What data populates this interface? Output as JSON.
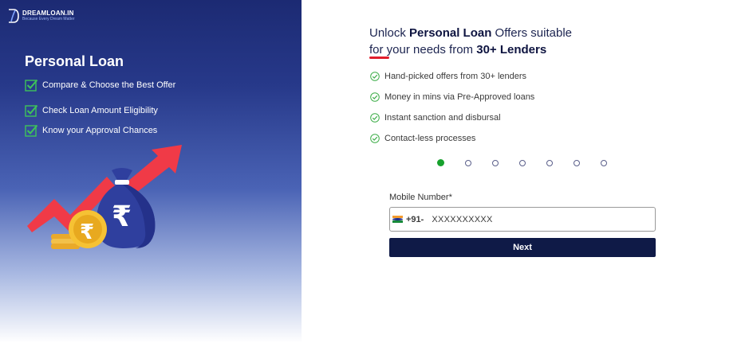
{
  "brand": {
    "name": "DREAMLOAN.IN",
    "tagline": "Because Every Dream Matter"
  },
  "left_panel": {
    "title": "Personal Loan",
    "features": [
      "Compare & Choose the Best Offer",
      "Check Loan Amount Eligibility",
      "Know your Approval Chances"
    ]
  },
  "headline": {
    "line1_prefix": "Unlock ",
    "line1_bold": "Personal Loan",
    "line1_suffix": " Offers suitable",
    "line2_prefix": "for your needs from ",
    "line2_bold": "30+ Lenders"
  },
  "benefits": [
    "Hand-picked offers from 30+ lenders",
    "Money in mins via Pre-Approved loans",
    "Instant sanction and disbursal",
    "Contact-less processes"
  ],
  "carousel": {
    "total_steps": 7,
    "active_step": 1
  },
  "form": {
    "mobile_label": "Mobile Number*",
    "country_code": "+91-",
    "mobile_placeholder": "XXXXXXXXXX",
    "mobile_value": "",
    "next_label": "Next"
  },
  "colors": {
    "accent_navy": "#0f1a47",
    "success_green": "#17a12d",
    "underline_red": "#e11d2b",
    "arrow_red": "#f03a47"
  },
  "icons": [
    "logo-icon",
    "check-box-icon",
    "check-circle-icon",
    "india-flag-icon",
    "money-bag-icon",
    "rupee-coin-icon",
    "growth-arrow-icon"
  ]
}
